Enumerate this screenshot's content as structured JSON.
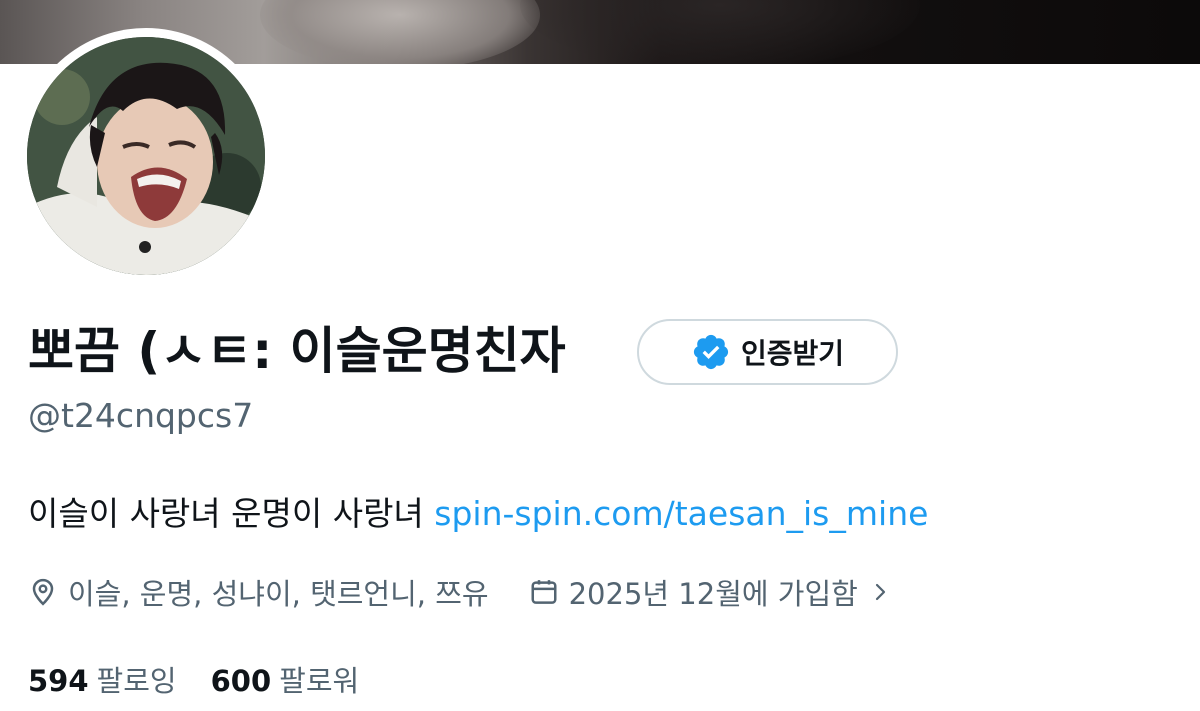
{
  "profile": {
    "display_name": "뽀끔 (ㅅㅌ: 이슬운명친자",
    "handle": "@t24cnqpcs7",
    "bio_text": "이슬이 사랑녀 운명이 사랑녀 ",
    "bio_link": "spin-spin.com/taesan_is_mine",
    "location": "이슬, 운명, 성냐이, 탯르언니, 쯔유",
    "joined": "2025년 12월에 가입함",
    "verify_button_label": "인증받기",
    "following_count": "594",
    "following_label": "팔로잉",
    "followers_count": "600",
    "followers_label": "팔로워"
  },
  "icons": {
    "location": "location-pin-icon",
    "calendar": "calendar-icon",
    "chevron": "chevron-right-icon",
    "verified": "verified-badge-icon"
  },
  "colors": {
    "text_primary": "#0f1419",
    "text_secondary": "#536471",
    "link": "#1d9bf0",
    "verified_badge": "#1d9bf0",
    "border": "#cfd9de"
  }
}
